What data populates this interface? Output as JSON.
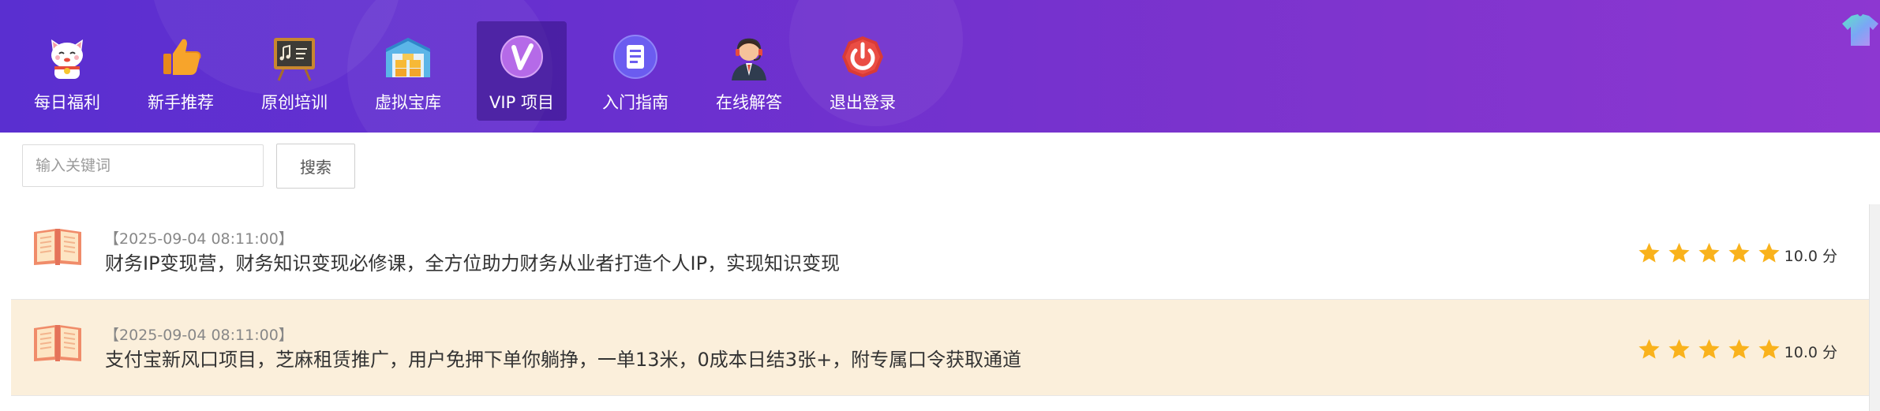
{
  "nav": {
    "items": [
      {
        "label": "每日福利",
        "icon": "lucky-cat-icon"
      },
      {
        "label": "新手推荐",
        "icon": "thumbs-up-icon"
      },
      {
        "label": "原创培训",
        "icon": "chalkboard-icon"
      },
      {
        "label": "虚拟宝库",
        "icon": "warehouse-icon"
      },
      {
        "label": "VIP 项目",
        "icon": "vip-icon",
        "active": true
      },
      {
        "label": "入门指南",
        "icon": "document-icon"
      },
      {
        "label": "在线解答",
        "icon": "support-agent-icon"
      },
      {
        "label": "退出登录",
        "icon": "power-icon"
      }
    ],
    "corner_icon": "tshirt-icon"
  },
  "search": {
    "placeholder": "输入关键词",
    "value": "",
    "button_label": "搜索"
  },
  "list": {
    "rows": [
      {
        "date": "【2025-09-04 08:11:00】",
        "title": "财务IP变现营，财务知识变现必修课，全方位助力财务从业者打造个人IP，实现知识变现",
        "stars": 5,
        "score": "10.0 分"
      },
      {
        "date": "【2025-09-04 08:11:00】",
        "title": "支付宝新风口项目，芝麻租赁推广，用户免押下单你躺挣，一单13米，0成本日结3张+，附专属口令获取通道",
        "stars": 5,
        "score": "10.0 分"
      }
    ]
  },
  "colors": {
    "header_gradient_start": "#5a2fd0",
    "header_gradient_end": "#8d37d1",
    "star": "#f9b21c",
    "alt_row": "#fbefdb",
    "book": "#f08c6a"
  }
}
